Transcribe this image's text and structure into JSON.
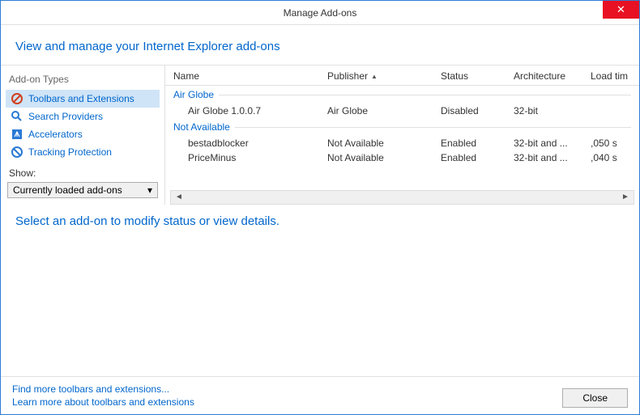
{
  "window": {
    "title": "Manage Add-ons"
  },
  "header": {
    "text": "View and manage your Internet Explorer add-ons"
  },
  "sidebar": {
    "title": "Add-on Types",
    "items": [
      {
        "label": "Toolbars and Extensions"
      },
      {
        "label": "Search Providers"
      },
      {
        "label": "Accelerators"
      },
      {
        "label": "Tracking Protection"
      }
    ],
    "show_label": "Show:",
    "dropdown_value": "Currently loaded add-ons"
  },
  "table": {
    "headers": {
      "name": "Name",
      "publisher": "Publisher",
      "status": "Status",
      "architecture": "Architecture",
      "load_time": "Load tim"
    },
    "groups": [
      {
        "title": "Air Globe",
        "rows": [
          {
            "name": "Air Globe 1.0.0.7",
            "publisher": "Air Globe",
            "status": "Disabled",
            "architecture": "32-bit",
            "load_time": ""
          }
        ]
      },
      {
        "title": "Not Available",
        "rows": [
          {
            "name": "bestadblocker",
            "publisher": "Not Available",
            "status": "Enabled",
            "architecture": "32-bit and ...",
            "load_time": ",050 s"
          },
          {
            "name": "PriceMinus",
            "publisher": "Not Available",
            "status": "Enabled",
            "architecture": "32-bit and ...",
            "load_time": ",040 s"
          }
        ]
      }
    ]
  },
  "detail": {
    "message": "Select an add-on to modify status or view details."
  },
  "footer": {
    "link1": "Find more toolbars and extensions...",
    "link2": "Learn more about toolbars and extensions",
    "close_label": "Close"
  }
}
